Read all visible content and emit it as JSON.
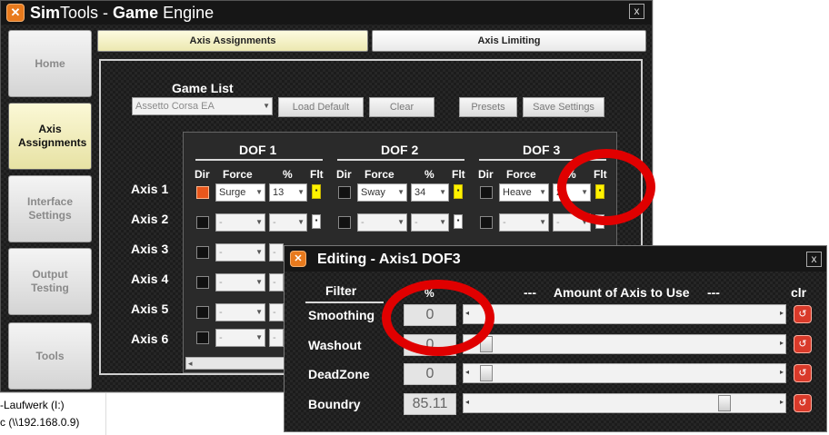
{
  "app": {
    "title_sim": "Sim",
    "title_tools": "Tools - ",
    "title_game": "Game",
    "title_engine": " Engine",
    "icon": "simtools-logo-icon",
    "close": "x"
  },
  "sidebar": {
    "items": [
      {
        "label": "Home"
      },
      {
        "label": "Axis Assignments"
      },
      {
        "label": "Interface Settings"
      },
      {
        "label": "Output Testing"
      },
      {
        "label": "Tools"
      }
    ]
  },
  "tabs": {
    "axis": "Axis Assignments",
    "limit": "Axis Limiting"
  },
  "game_list": {
    "label": "Game List",
    "selected": "Assetto Corsa EA",
    "load_default": "Load Default",
    "clear": "Clear",
    "presets": "Presets",
    "save_settings": "Save Settings"
  },
  "dof": {
    "labels": [
      "DOF 1",
      "DOF 2",
      "DOF 3"
    ],
    "col_dir": "Dir",
    "col_force": "Force",
    "col_pct": "%",
    "col_flt": "Flt"
  },
  "axes": [
    {
      "label": "Axis 1",
      "dof1": {
        "force": "Surge",
        "pct": "13"
      },
      "dof2": {
        "force": "Sway",
        "pct": "34"
      },
      "dof3": {
        "force": "Heave",
        "pct": "2"
      }
    },
    {
      "label": "Axis 2",
      "dash": "-"
    },
    {
      "label": "Axis 3"
    },
    {
      "label": "Axis 4"
    },
    {
      "label": "Axis 5"
    },
    {
      "label": "Axis 6"
    }
  ],
  "explorer": {
    "row1": "-Laufwerk (I:)",
    "row2": "c (\\\\192.168.0.9)"
  },
  "editor": {
    "title": "Editing - Axis1 DOF3",
    "close": "x",
    "filter_header": "Filter",
    "pct_header": "%",
    "amount_header": "---     Amount of Axis to Use     ---",
    "clr_header": "clr",
    "rows": [
      {
        "label": "Smoothing",
        "value": "0",
        "slider_pct": 0
      },
      {
        "label": "Washout",
        "value": "0",
        "slider_pct": 0
      },
      {
        "label": "DeadZone",
        "value": "0",
        "slider_pct": 0
      },
      {
        "label": "Boundry",
        "value": "85.11",
        "slider_pct": 85.11
      }
    ]
  },
  "colors": {
    "accent_orange": "#e87a1d",
    "highlight_red": "#e00000",
    "flt_yellow": "#fff200",
    "active_tab": "#ece8b0"
  }
}
